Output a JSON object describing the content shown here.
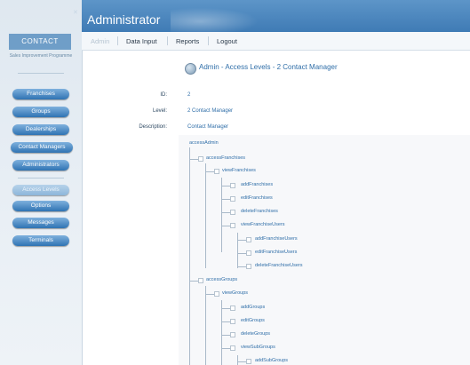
{
  "app": {
    "logo": "CONTACT",
    "tagline": "Sales Improvement Programme"
  },
  "header": {
    "title": "Administrator"
  },
  "nav": {
    "items": [
      "Admin",
      "Data Input",
      "Reports",
      "Logout"
    ]
  },
  "sidebar": {
    "items": [
      {
        "label": "Franchises"
      },
      {
        "label": "Groups"
      },
      {
        "label": "Dealerships"
      },
      {
        "label": "Contact Managers"
      },
      {
        "label": "Administrators"
      },
      {
        "label": "Access Levels"
      },
      {
        "label": "Options"
      },
      {
        "label": "Messages"
      },
      {
        "label": "Terminals"
      }
    ]
  },
  "page": {
    "title": "Admin - Access Levels - 2 Contact Manager"
  },
  "details": {
    "id_label": "ID:",
    "id_value": "2",
    "level_label": "Level:",
    "level_value": "2 Contact Manager",
    "desc_label": "Description:",
    "desc_value": "Contact Manager"
  },
  "tree": {
    "nodes": [
      "accessAdmin",
      "accessFranchises",
      "viewFranchises",
      "addFranchises",
      "editFranchises",
      "deleteFranchises",
      "viewFranchiseUsers",
      "addFranchiseUsers",
      "editFranchiseUsers",
      "deleteFranchiseUsers",
      "accessGroups",
      "viewGroups",
      "addGroups",
      "editGroups",
      "deleteGroups",
      "viewSubGroups",
      "addSubGroups"
    ]
  }
}
